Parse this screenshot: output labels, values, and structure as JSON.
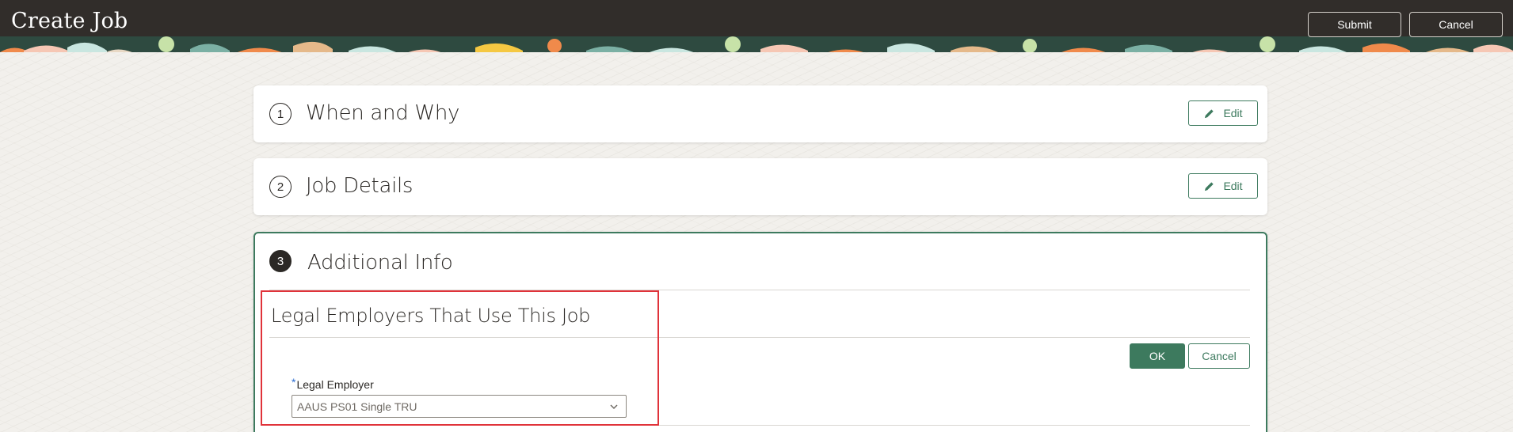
{
  "header": {
    "title": "Create Job",
    "submit_label": "Submit",
    "cancel_label": "Cancel"
  },
  "steps": [
    {
      "number": "1",
      "title": "When and Why",
      "edit_label": "Edit"
    },
    {
      "number": "2",
      "title": "Job Details",
      "edit_label": "Edit"
    },
    {
      "number": "3",
      "title": "Additional Info"
    }
  ],
  "additional_info": {
    "section_title": "Legal Employers That Use This Job",
    "ok_label": "OK",
    "cancel_label": "Cancel",
    "field": {
      "required_marker": "*",
      "label": "Legal Employer",
      "value": "AAUS PS01 Single TRU"
    }
  },
  "colors": {
    "accent": "#3d7a5e",
    "header_bg": "#312d2a",
    "highlight": "#e0333a"
  },
  "icons": [
    "pencil-icon",
    "chevron-down-icon"
  ]
}
